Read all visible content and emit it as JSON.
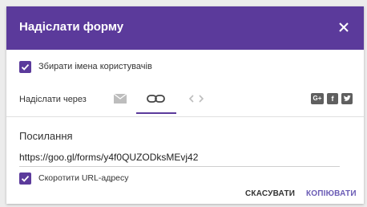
{
  "dialog": {
    "title": "Надіслати форму",
    "close_icon": "close-icon"
  },
  "options": {
    "collect_emails_label": "Збирати імена користувачів",
    "collect_emails_checked": true,
    "shorten_url_label": "Скоротити URL-адресу",
    "shorten_url_checked": true
  },
  "send_via": {
    "label": "Надіслати через",
    "tabs": [
      {
        "icon": "email-icon",
        "selected": false
      },
      {
        "icon": "link-icon",
        "selected": true
      },
      {
        "icon": "embed-code-icon",
        "selected": false
      }
    ],
    "social": [
      {
        "icon": "google-plus-icon",
        "glyph": "G+"
      },
      {
        "icon": "facebook-icon",
        "glyph": "f"
      },
      {
        "icon": "twitter-icon",
        "glyph": ""
      }
    ]
  },
  "link_section": {
    "title": "Посилання",
    "url": "https://goo.gl/forms/y4f0QUZODksMEvj42"
  },
  "actions": {
    "cancel": "СКАСУВАТИ",
    "copy": "КОПІЮВАТИ"
  },
  "colors": {
    "header": "#5b3a9b",
    "accent": "#5b3a9b",
    "copy_button": "#6a5bb5"
  }
}
